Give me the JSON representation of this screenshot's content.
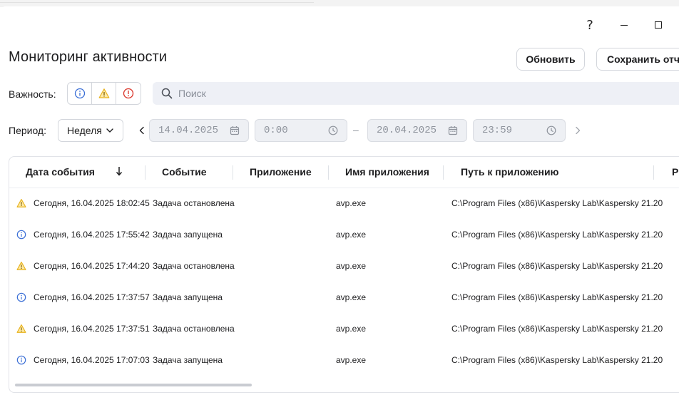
{
  "window": {
    "help_label": "?"
  },
  "page": {
    "title": "Мониторинг активности"
  },
  "toolbar": {
    "refresh_label": "Обновить",
    "save_label": "Сохранить отчет"
  },
  "filters": {
    "severity_label": "Важность:",
    "severity_options": [
      {
        "name": "info",
        "color": "#3b6fd6"
      },
      {
        "name": "warning",
        "color": "#e8b21c"
      },
      {
        "name": "critical",
        "color": "#d93025"
      }
    ],
    "search_placeholder": "Поиск",
    "period_label": "Период:",
    "period_value": "Неделя",
    "date_from": "14.04.2025",
    "time_from": "0:00",
    "date_to": "20.04.2025",
    "time_to": "23:59",
    "range_dash": "–"
  },
  "table": {
    "columns": [
      "Дата события",
      "Событие",
      "Приложение",
      "Имя приложения",
      "Путь к приложению",
      "PI"
    ],
    "rows": [
      {
        "severity": "warning",
        "date": "Сегодня, 16.04.2025 18:02:45",
        "event": "Задача остановлена",
        "app": "",
        "app_name": "avp.exe",
        "path": "C:\\Program Files (x86)\\Kaspersky Lab\\Kaspersky 21.20"
      },
      {
        "severity": "info",
        "date": "Сегодня, 16.04.2025 17:55:42",
        "event": "Задача запущена",
        "app": "",
        "app_name": "avp.exe",
        "path": "C:\\Program Files (x86)\\Kaspersky Lab\\Kaspersky 21.20"
      },
      {
        "severity": "warning",
        "date": "Сегодня, 16.04.2025 17:44:20",
        "event": "Задача остановлена",
        "app": "",
        "app_name": "avp.exe",
        "path": "C:\\Program Files (x86)\\Kaspersky Lab\\Kaspersky 21.20"
      },
      {
        "severity": "info",
        "date": "Сегодня, 16.04.2025 17:37:57",
        "event": "Задача запущена",
        "app": "",
        "app_name": "avp.exe",
        "path": "C:\\Program Files (x86)\\Kaspersky Lab\\Kaspersky 21.20"
      },
      {
        "severity": "warning",
        "date": "Сегодня, 16.04.2025 17:37:51",
        "event": "Задача остановлена",
        "app": "",
        "app_name": "avp.exe",
        "path": "C:\\Program Files (x86)\\Kaspersky Lab\\Kaspersky 21.20"
      },
      {
        "severity": "info",
        "date": "Сегодня, 16.04.2025 17:07:03",
        "event": "Задача запущена",
        "app": "",
        "app_name": "avp.exe",
        "path": "C:\\Program Files (x86)\\Kaspersky Lab\\Kaspersky 21.20"
      }
    ]
  }
}
